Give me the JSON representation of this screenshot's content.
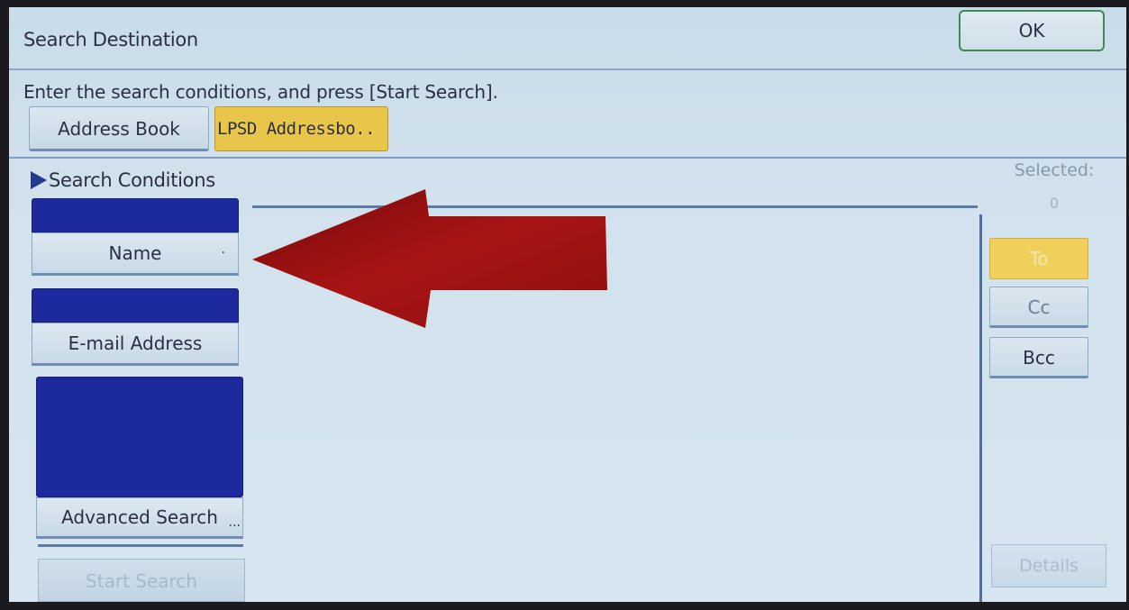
{
  "header": {
    "title": "Search Destination",
    "ok_label": "OK"
  },
  "instruction": "Enter the search conditions, and press [Start Search].",
  "tabs": [
    {
      "label": "Address Book"
    },
    {
      "label": "LPSD Addressbo.."
    }
  ],
  "search": {
    "section_title": "Search Conditions",
    "fields": [
      {
        "label": "Name",
        "value": ""
      },
      {
        "label": "E-mail Address",
        "value": ""
      }
    ],
    "advanced_label": "Advanced Search",
    "advanced_suffix": "...",
    "start_label": "Start Search"
  },
  "selection": {
    "label": "Selected:",
    "count": "0",
    "to_label": "To",
    "cc_label": "Cc",
    "bcc_label": "Bcc",
    "details_label": "Details"
  },
  "colors": {
    "field_fill": "#1d2a9e",
    "active_tab": "#e8c64a",
    "annotation_arrow": "#9a1010"
  },
  "icons": {
    "section_marker": "triangle-right-icon",
    "annotation": "red-arrow-left-icon"
  }
}
